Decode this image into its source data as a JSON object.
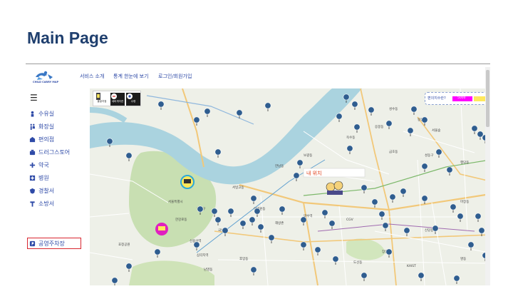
{
  "slide": {
    "title": "Main Page"
  },
  "header": {
    "logo_text": "CHILD CARRY MAP",
    "nav": [
      "서비스 소개",
      "통계 한눈에 보기",
      "로그인/회원가입"
    ]
  },
  "sidebar": {
    "menu_icon": "hamburger-icon",
    "items": [
      {
        "label": "수유실",
        "icon": "baby-icon"
      },
      {
        "label": "화장실",
        "icon": "restroom-icon"
      },
      {
        "label": "편의점",
        "icon": "store-icon"
      },
      {
        "label": "드러그스토어",
        "icon": "drugstore-icon"
      },
      {
        "label": "약국",
        "icon": "pharmacy-icon"
      },
      {
        "label": "병원",
        "icon": "hospital-icon"
      },
      {
        "label": "경찰서",
        "icon": "police-icon"
      },
      {
        "label": "소방서",
        "icon": "fire-station-icon"
      },
      {
        "label": "공영주차장",
        "icon": "parking-icon",
        "highlighted": true
      }
    ]
  },
  "map": {
    "controls": [
      {
        "label": "출발지점",
        "icon": "start-point-icon"
      },
      {
        "label": "네비게이션",
        "icon": "navigation-icon"
      },
      {
        "label": "수령",
        "icon": "pickup-icon"
      }
    ],
    "my_location_label": "내 위치",
    "legend": {
      "label": "편의지수란?",
      "value": "5000"
    },
    "colors": {
      "river": "#aad3df",
      "park": "#c8dfb2",
      "road_major": "#f2c879",
      "pin": "#2f5d8f",
      "legend_bar": "#ff00ff"
    },
    "place_labels": [
      "서울특별시",
      "용산구",
      "서빙고동",
      "한남동",
      "이태원동",
      "한강로동",
      "국방부",
      "신용산역",
      "삼각지역",
      "효창공원",
      "남영동",
      "후암동",
      "해방촌",
      "보광동",
      "성수동",
      "옥수동",
      "금호동",
      "성동구",
      "왕십리",
      "CGV",
      "약수역",
      "신당동",
      "장충동",
      "명동",
      "KAIST",
      "서울숲",
      "응봉동",
      "행당동",
      "마장동",
      "도선동"
    ]
  }
}
